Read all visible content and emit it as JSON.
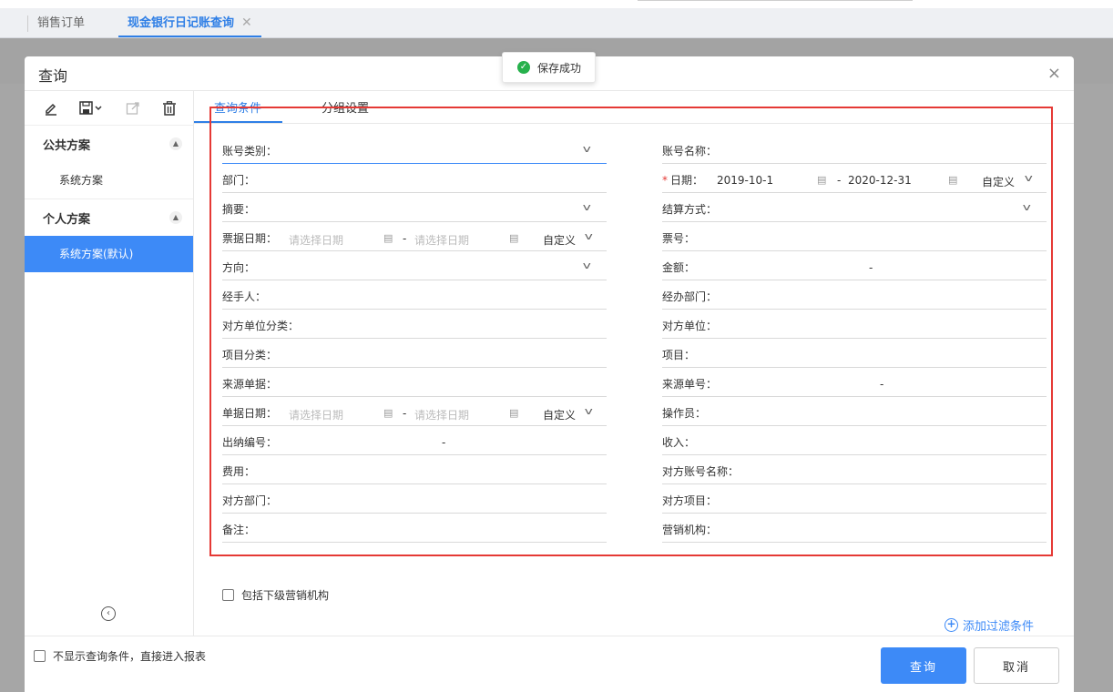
{
  "app_tabs": [
    {
      "label": "销售订单"
    },
    {
      "label": "现金银行日记账查询",
      "close": "✕"
    }
  ],
  "toast": {
    "message": "保存成功"
  },
  "dialog": {
    "title": "查询",
    "close": "×",
    "groups": {
      "public": {
        "label": "公共方案",
        "items": [
          "系统方案"
        ]
      },
      "personal": {
        "label": "个人方案",
        "items": [
          "系统方案(默认)"
        ]
      }
    },
    "tabs": [
      "查询条件",
      "分组设置"
    ],
    "left_fields": {
      "account_type": "账号类别：",
      "department": "部门：",
      "summary": "摘要：",
      "bill_date": "票据日期：",
      "bill_date_start_ph": "请选择日期",
      "bill_date_end_ph": "请选择日期",
      "bill_date_mode": "自定义",
      "direction": "方向：",
      "handler": "经手人：",
      "counterparty_category": "对方单位分类：",
      "project_category": "项目分类：",
      "source_document": "来源单据：",
      "doc_date": "单据日期：",
      "doc_date_start_ph": "请选择日期",
      "doc_date_end_ph": "请选择日期",
      "doc_date_mode": "自定义",
      "cashier_no": "出纳编号：",
      "expense": "费用：",
      "counterparty_dept": "对方部门：",
      "remark": "备注："
    },
    "right_fields": {
      "account_name": "账号名称：",
      "date": "日期：",
      "date_start": "2019-10-1",
      "date_end": "2020-12-31",
      "date_mode": "自定义",
      "settlement": "结算方式：",
      "ticket_no": "票号：",
      "amount": "金额：",
      "handler_dept": "经办部门：",
      "counterparty": "对方单位：",
      "project": "项目：",
      "source_no": "来源单号：",
      "operator": "操作员：",
      "income": "收入：",
      "counterparty_account_name": "对方账号名称：",
      "counterparty_project": "对方项目：",
      "sales_org": "营销机构："
    },
    "range_sep": "-",
    "required_mark": "*",
    "include_sub_orgs": "包括下级营销机构",
    "add_filter": "添加过滤条件",
    "skip_conditions": "不显示查询条件，直接进入报表",
    "query_button": "查询",
    "cancel_button": "取消"
  },
  "colors": {
    "accent": "#3d8af7",
    "highlight": "#e53935",
    "success": "#27b14c"
  }
}
